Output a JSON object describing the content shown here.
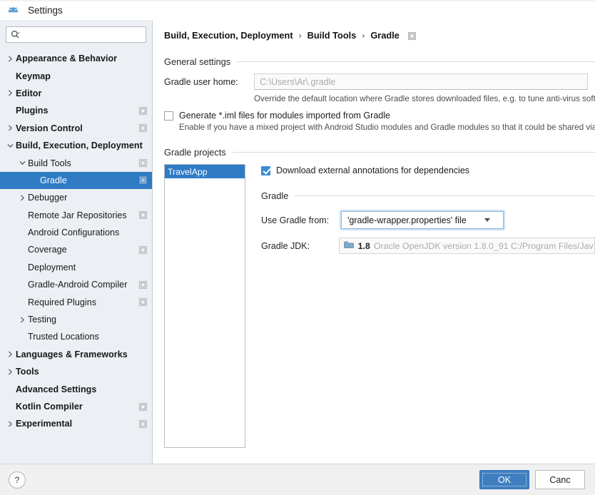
{
  "window": {
    "title": "Settings",
    "icon": "android-studio-icon"
  },
  "sidebar": {
    "search": {
      "value": "",
      "placeholder": ""
    },
    "items": [
      {
        "label": "Appearance & Behavior",
        "arrow": "collapsed",
        "indent": 0,
        "bold": true,
        "badge": false,
        "selected": false
      },
      {
        "label": "Keymap",
        "arrow": "none",
        "indent": 0,
        "bold": true,
        "badge": false,
        "selected": false
      },
      {
        "label": "Editor",
        "arrow": "collapsed",
        "indent": 0,
        "bold": true,
        "badge": false,
        "selected": false
      },
      {
        "label": "Plugins",
        "arrow": "none",
        "indent": 0,
        "bold": true,
        "badge": true,
        "selected": false
      },
      {
        "label": "Version Control",
        "arrow": "collapsed",
        "indent": 0,
        "bold": true,
        "badge": true,
        "selected": false
      },
      {
        "label": "Build, Execution, Deployment",
        "arrow": "expanded",
        "indent": 0,
        "bold": true,
        "badge": false,
        "selected": false
      },
      {
        "label": "Build Tools",
        "arrow": "expanded",
        "indent": 1,
        "bold": false,
        "badge": true,
        "selected": false
      },
      {
        "label": "Gradle",
        "arrow": "none",
        "indent": 2,
        "bold": false,
        "badge": true,
        "selected": true
      },
      {
        "label": "Debugger",
        "arrow": "collapsed",
        "indent": 1,
        "bold": false,
        "badge": false,
        "selected": false
      },
      {
        "label": "Remote Jar Repositories",
        "arrow": "none",
        "indent": 1,
        "bold": false,
        "badge": true,
        "selected": false
      },
      {
        "label": "Android Configurations",
        "arrow": "none",
        "indent": 1,
        "bold": false,
        "badge": false,
        "selected": false
      },
      {
        "label": "Coverage",
        "arrow": "none",
        "indent": 1,
        "bold": false,
        "badge": true,
        "selected": false
      },
      {
        "label": "Deployment",
        "arrow": "none",
        "indent": 1,
        "bold": false,
        "badge": false,
        "selected": false
      },
      {
        "label": "Gradle-Android Compiler",
        "arrow": "none",
        "indent": 1,
        "bold": false,
        "badge": true,
        "selected": false
      },
      {
        "label": "Required Plugins",
        "arrow": "none",
        "indent": 1,
        "bold": false,
        "badge": true,
        "selected": false
      },
      {
        "label": "Testing",
        "arrow": "collapsed",
        "indent": 1,
        "bold": false,
        "badge": false,
        "selected": false
      },
      {
        "label": "Trusted Locations",
        "arrow": "none",
        "indent": 1,
        "bold": false,
        "badge": false,
        "selected": false
      },
      {
        "label": "Languages & Frameworks",
        "arrow": "collapsed",
        "indent": 0,
        "bold": true,
        "badge": false,
        "selected": false
      },
      {
        "label": "Tools",
        "arrow": "collapsed",
        "indent": 0,
        "bold": true,
        "badge": false,
        "selected": false
      },
      {
        "label": "Advanced Settings",
        "arrow": "none",
        "indent": 0,
        "bold": true,
        "badge": false,
        "selected": false
      },
      {
        "label": "Kotlin Compiler",
        "arrow": "none",
        "indent": 0,
        "bold": true,
        "badge": true,
        "selected": false
      },
      {
        "label": "Experimental",
        "arrow": "collapsed",
        "indent": 0,
        "bold": true,
        "badge": true,
        "selected": false
      }
    ]
  },
  "content": {
    "breadcrumb": {
      "parts": [
        "Build, Execution, Deployment",
        "Build Tools",
        "Gradle"
      ],
      "separator": "›"
    },
    "general_settings": {
      "title": "General settings",
      "gradle_user_home": {
        "label": "Gradle user home:",
        "value": "",
        "placeholder": "C:\\Users\\Ar\\.gradle",
        "hint": "Override the default location where Gradle stores downloaded files, e.g. to tune anti-virus software"
      },
      "generate_iml": {
        "label": "Generate *.iml files for modules imported from Gradle",
        "checked": false,
        "hint": "Enable if you have a mixed project with Android Studio modules and Gradle modules so that it could be shared via VCS"
      }
    },
    "gradle_projects": {
      "title": "Gradle projects",
      "projects": [
        "TravelApp"
      ],
      "selected_project": "TravelApp",
      "download_annotations": {
        "label": "Download external annotations for dependencies",
        "checked": true
      },
      "gradle_section": {
        "title": "Gradle",
        "use_gradle_from": {
          "label": "Use Gradle from:",
          "value": "'gradle-wrapper.properties' file"
        },
        "gradle_jdk": {
          "label": "Gradle JDK:",
          "version": "1.8",
          "description": "Oracle OpenJDK version 1.8.0_91 C:/Program Files/Jav"
        }
      }
    }
  },
  "footer": {
    "help_label": "?",
    "ok_label": "OK",
    "cancel_label": "Canc"
  },
  "colors": {
    "selection_blue": "#2f7bc4",
    "primary_button": "#3f7fc1",
    "sidebar_bg": "#eceff3",
    "checkbox_checked": "#3b8ad8"
  }
}
